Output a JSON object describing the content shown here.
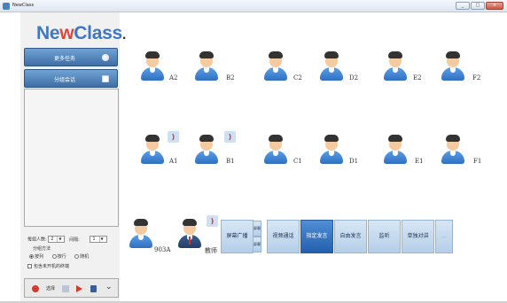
{
  "window": {
    "title": "NewClass",
    "buttons": [
      "_",
      "□",
      "×"
    ]
  },
  "logo": {
    "text_a": "Ne",
    "text_w": "w",
    "text_b": "Class",
    "text_dot": "."
  },
  "sidebar": {
    "nav": [
      {
        "label": "更多任务",
        "icon": "circle-icon"
      },
      {
        "label": "分组会话",
        "icon": "square-icon"
      }
    ],
    "group_settings": {
      "size_label": "每组人数:",
      "size_value": "2",
      "gap_label": "间隔:",
      "gap_value": "1",
      "method_label": "分组方法",
      "options": [
        "按列",
        "按行",
        "随机"
      ],
      "selected": "按列",
      "include_offline": "包含未开机的终端"
    },
    "toolbar": {
      "icons": [
        "apple-icon",
        "dots-icon",
        "arrow-icon",
        "flag-icon",
        "trash-icon",
        "chevron-down-icon"
      ],
      "mini_label": "选择"
    }
  },
  "students": [
    {
      "name": "A2",
      "speaker": false
    },
    {
      "name": "B2",
      "speaker": false
    },
    {
      "name": "C2",
      "speaker": false
    },
    {
      "name": "D2",
      "speaker": false
    },
    {
      "name": "E2",
      "speaker": false
    },
    {
      "name": "F2",
      "speaker": false
    },
    {
      "name": "A1",
      "speaker": true
    },
    {
      "name": "B1",
      "speaker": true
    },
    {
      "name": "C1",
      "speaker": false
    },
    {
      "name": "D1",
      "speaker": false
    },
    {
      "name": "E1",
      "speaker": false
    },
    {
      "name": "F1",
      "speaker": false
    },
    {
      "name": "903A",
      "speaker": false
    },
    {
      "name": "教师",
      "speaker": true,
      "teacher": true
    }
  ],
  "actions": {
    "screen_broadcast": "屏幕广播",
    "mini_top": "屏幕",
    "mini_bottom": "屏幕",
    "video_call": "视频通话",
    "designated_speak": "指定发言",
    "free_speak": "自由发言",
    "monitor": "监听",
    "one_to_one": "单独对讲",
    "more": "..."
  },
  "colors": {
    "accent": "#3e77c4",
    "logo_w": "#e0463a",
    "active_button": "#245fae",
    "speaker": "#d8322a"
  }
}
